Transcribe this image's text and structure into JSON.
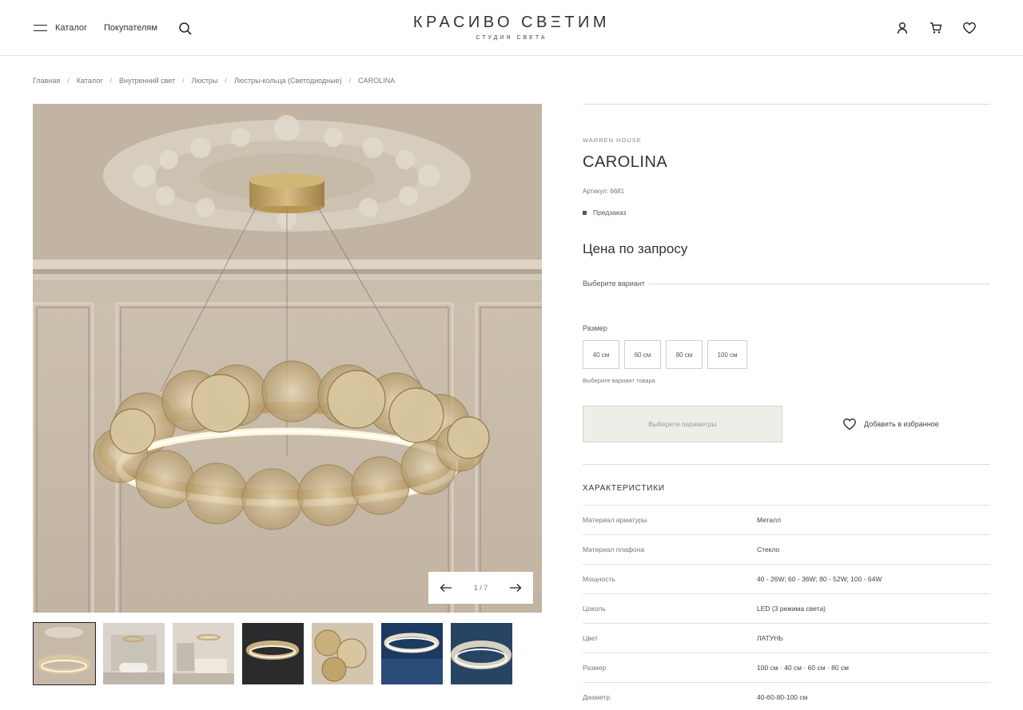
{
  "header": {
    "nav": [
      "Каталог",
      "Покупателям"
    ],
    "logo_main": "КРАСИВО СВΞТИМ",
    "logo_sub": "СТУДИЯ СВЕТА",
    "icons": [
      "menu-icon",
      "search-icon",
      "user-icon",
      "cart-icon",
      "heart-icon"
    ]
  },
  "breadcrumb": [
    "Главная",
    "Каталог",
    "Внутренний свет",
    "Люстры",
    "Люстры-кольца (Светодиодные)",
    "CAROLINA"
  ],
  "gallery": {
    "counter": "1 / 7",
    "thumb_count": 7
  },
  "product": {
    "brand": "WARREN HOUSE",
    "title": "CAROLINA",
    "sku": "Артикул: 6681",
    "status": "Предзаказ",
    "price": "Цена по запросу",
    "variant_label": "Выберите вариант",
    "size_label": "Размер",
    "sizes": [
      "40 см",
      "60 см",
      "80 см",
      "100 см"
    ],
    "hint": "Выберите вариант товара",
    "cta": "Выберите параметры",
    "favorite": "Добавить в избранное"
  },
  "specs": {
    "title": "ХАРАКТЕРИСТИКИ",
    "rows": [
      {
        "k": "Материал арматуры",
        "v": "Металл"
      },
      {
        "k": "Материал плафона",
        "v": "Стекло"
      },
      {
        "k": "Мощность",
        "v": "40 - 26W; 60 - 36W; 80 - 52W; 100 - 64W"
      },
      {
        "k": "Цоколь",
        "v": "LED (3 режима света)"
      },
      {
        "k": "Цвет",
        "v": "ЛАТУНЬ"
      },
      {
        "k": "Размер",
        "v": "100 см · 40 см · 60 см · 80 см"
      },
      {
        "k": "Диаметр",
        "v": "40-60-80-100 см"
      }
    ]
  },
  "colors": {
    "accent_gold": "#c2a064",
    "wall": "#c9bcab",
    "cta_bg": "#efede8"
  }
}
